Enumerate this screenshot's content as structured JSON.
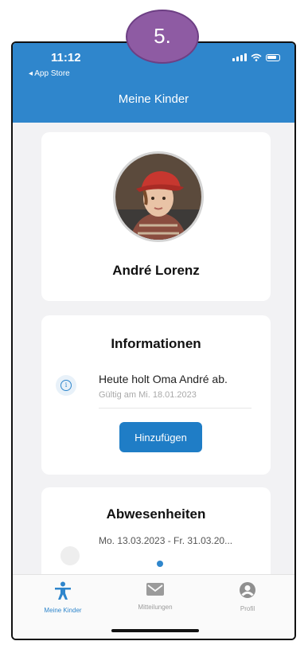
{
  "status_bar": {
    "time": "11:12",
    "back_label": "◂ App Store"
  },
  "nav": {
    "title": "Meine Kinder"
  },
  "step_badge": "5.",
  "child": {
    "name": "André Lorenz"
  },
  "info_card": {
    "title": "Informationen",
    "message": "Heute holt Oma André ab.",
    "valid": "Gültig am Mi. 18.01.2023",
    "add_label": "Hinzufügen"
  },
  "absence_card": {
    "title": "Abwesenheiten",
    "entry": "Mo. 13.03.2023 - Fr. 31.03.20..."
  },
  "tabs": [
    {
      "label": "Meine Kinder",
      "icon": "child-icon",
      "active": true
    },
    {
      "label": "Mitteilungen",
      "icon": "mail-icon",
      "active": false
    },
    {
      "label": "Profil",
      "icon": "person-icon",
      "active": false
    }
  ],
  "colors": {
    "accent": "#2f86cc",
    "badge": "#8e5ba3",
    "background": "#f2f2f4"
  }
}
